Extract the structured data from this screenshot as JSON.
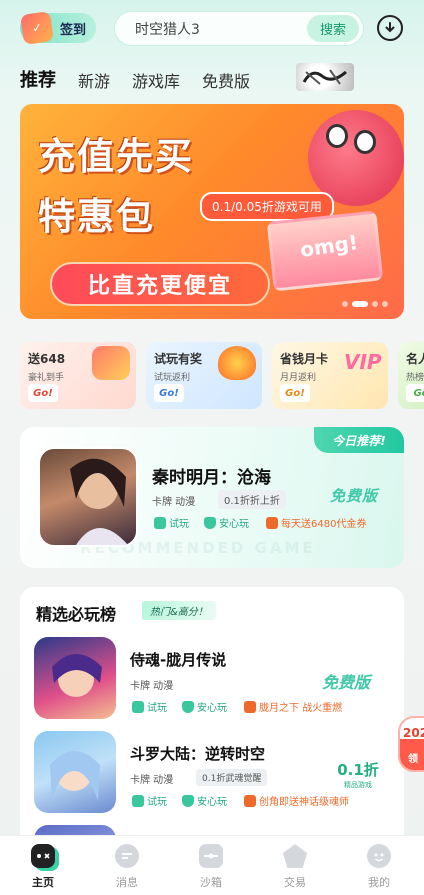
{
  "header": {
    "checkin_label": "签到",
    "search_value": "时空猎人3",
    "search_button": "搜索"
  },
  "tabs": [
    {
      "label": "推荐"
    },
    {
      "label": "新游"
    },
    {
      "label": "游戏库"
    },
    {
      "label": "免费版"
    }
  ],
  "banner": {
    "title_line1": "充值先买",
    "title_line2": "特惠包",
    "tag": "0.1/0.05折游戏可用",
    "pill": "比直充更便宜",
    "mascot_text": "omg!"
  },
  "promos": [
    {
      "title": "送648",
      "subtitle": "豪礼到手",
      "go": "Go!",
      "accent": "#ffe3dd"
    },
    {
      "title": "试玩有奖",
      "subtitle": "试玩返利",
      "go": "Go!",
      "accent": "#dff0ff"
    },
    {
      "title": "省钱月卡",
      "subtitle": "月月返利",
      "go": "Go!",
      "accent": "#fff3d6"
    },
    {
      "title": "名人",
      "subtitle": "热榜",
      "go": "Go",
      "accent": "#e7f8dd"
    }
  ],
  "recommend": {
    "badge": "今日推荐!",
    "title": "秦时明月：沧海",
    "category": "卡牌 动漫",
    "chip": "0.1折折上折",
    "free_badge": "免费版",
    "features": [
      "试玩",
      "安心玩",
      "每天送6480代金券"
    ],
    "watermark": "RECOMMENDED GAME"
  },
  "ranking": {
    "title": "精选必玩榜",
    "subtitle": "热门&高分！",
    "games": [
      {
        "name": "侍魂-胧月传说",
        "category": "卡牌 动漫",
        "chip": "",
        "badge": "免费版",
        "discount_value": "",
        "discount_label": "",
        "features": [
          "试玩",
          "安心玩",
          "胧月之下 战火重燃"
        ]
      },
      {
        "name": "斗罗大陆：逆转时空",
        "category": "卡牌 动漫",
        "chip": "0.1折武魂觉醒",
        "badge": "",
        "discount_value": "0.1折",
        "discount_label": "精品游戏",
        "features": [
          "试玩",
          "安心玩",
          "创角即送神话级魂师"
        ]
      }
    ]
  },
  "float_badge": {
    "year": "202",
    "text": "领"
  },
  "bottom_nav": [
    {
      "label": "主页",
      "icon": "controller-icon",
      "active": true
    },
    {
      "label": "消息",
      "icon": "chat-icon",
      "active": false
    },
    {
      "label": "沙箱",
      "icon": "sandbox-icon",
      "active": false
    },
    {
      "label": "交易",
      "icon": "trade-icon",
      "active": false
    },
    {
      "label": "我的",
      "icon": "profile-icon",
      "active": false
    }
  ],
  "colors": {
    "accent": "#39d4a6",
    "orange": "#ee6a2a"
  }
}
